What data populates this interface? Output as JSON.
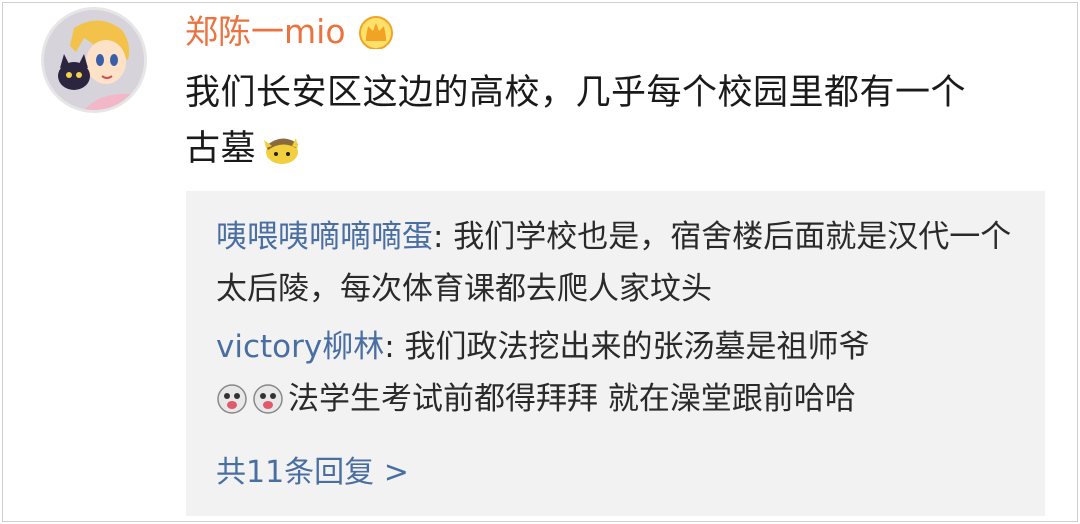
{
  "post": {
    "username": "郑陈一mio",
    "badge_icon": "vip-crown-icon",
    "text_line1": "我们长安区这边的高校，几乎每个校园里都有一个",
    "text_line2": "古墓",
    "emoji": "detective-pikachu-emoji"
  },
  "replies": [
    {
      "user": "咦喂咦嘀嘀嘀蛋",
      "text": ": 我们学校也是，宿舍楼后面就是汉代一个太后陵，每次体育课都去爬人家坟头"
    },
    {
      "user": "victory柳林",
      "text_line1": ": 我们政法挖出来的张汤墓是祖师爷",
      "emoji": "doge-emoji",
      "text_line2": "法学生考试前都得拜拜 就在澡堂跟前哈哈"
    }
  ],
  "more_replies": "共11条回复 >",
  "colors": {
    "username": "#eb7340",
    "link": "#496ea1",
    "reply_bg": "#f2f2f2"
  }
}
